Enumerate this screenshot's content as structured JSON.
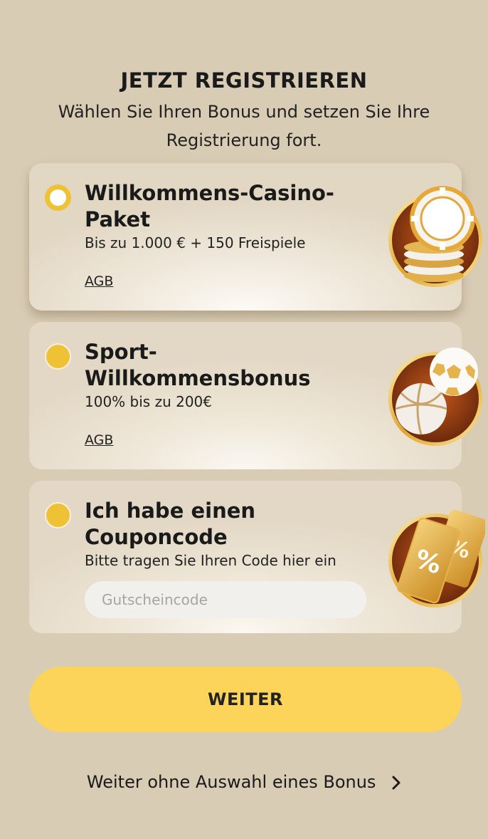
{
  "header": {
    "title": "JETZT REGISTRIEREN",
    "subtitle": "Wählen Sie Ihren Bonus und setzen Sie Ihre Registrierung fort."
  },
  "bonus_options": [
    {
      "title": "Willkommens-Casino-Paket",
      "description": "Bis zu 1.000 € + 150 Freispiele",
      "link_label": "AGB",
      "selected": true,
      "icon": "casino-chips-icon"
    },
    {
      "title": "Sport-Willkommensbonus",
      "description": "100% bis zu 200€",
      "link_label": "AGB",
      "selected": false,
      "icon": "sport-balls-icon"
    },
    {
      "title": "Ich habe einen Couponcode",
      "description": "Bitte tragen Sie Ihren Code hier ein",
      "input_placeholder": "Gutscheincode",
      "input_value": "",
      "selected": false,
      "icon": "coupon-tickets-icon"
    }
  ],
  "actions": {
    "continue_label": "WEITER",
    "skip_label": "Weiter ohne Auswahl eines Bonus"
  },
  "colors": {
    "background": "#d9ccb5",
    "accent": "#efc236",
    "button": "#fcd45a"
  }
}
